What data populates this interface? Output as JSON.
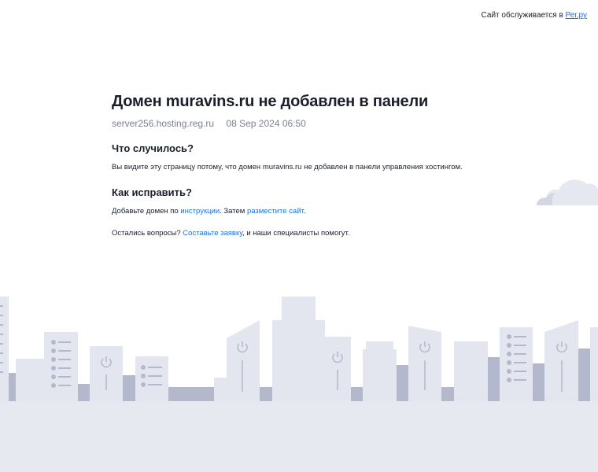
{
  "topbar": {
    "text": "Сайт обслуживается в",
    "link": "Рег.ру"
  },
  "main": {
    "title": "Домен muravins.ru не добавлен в панели",
    "server": "server256.hosting.reg.ru",
    "datetime": "08 Sep 2024 06:50",
    "what_happened": {
      "heading": "Что случилось?",
      "text": "Вы видите эту страницу потому, что домен muravins.ru не добавлен в панели управления хостингом."
    },
    "how_to_fix": {
      "heading": "Как исправить?",
      "prefix": "Добавьте домен по",
      "link1": "инструкции",
      "middle": ". Затем",
      "link2": "разместите сайт",
      "suffix": "."
    },
    "questions": {
      "prefix": "Остались вопросы?",
      "link": "Составьте заявку",
      "suffix": ", и наши специалисты помогут."
    }
  },
  "colors": {
    "accent_link": "#1a73e8",
    "building_light": "#e3e6ee",
    "building_dark": "#b3b8cc",
    "ground": "#e7e9f0"
  },
  "icons": [
    "cloud-icon",
    "power-icon"
  ]
}
